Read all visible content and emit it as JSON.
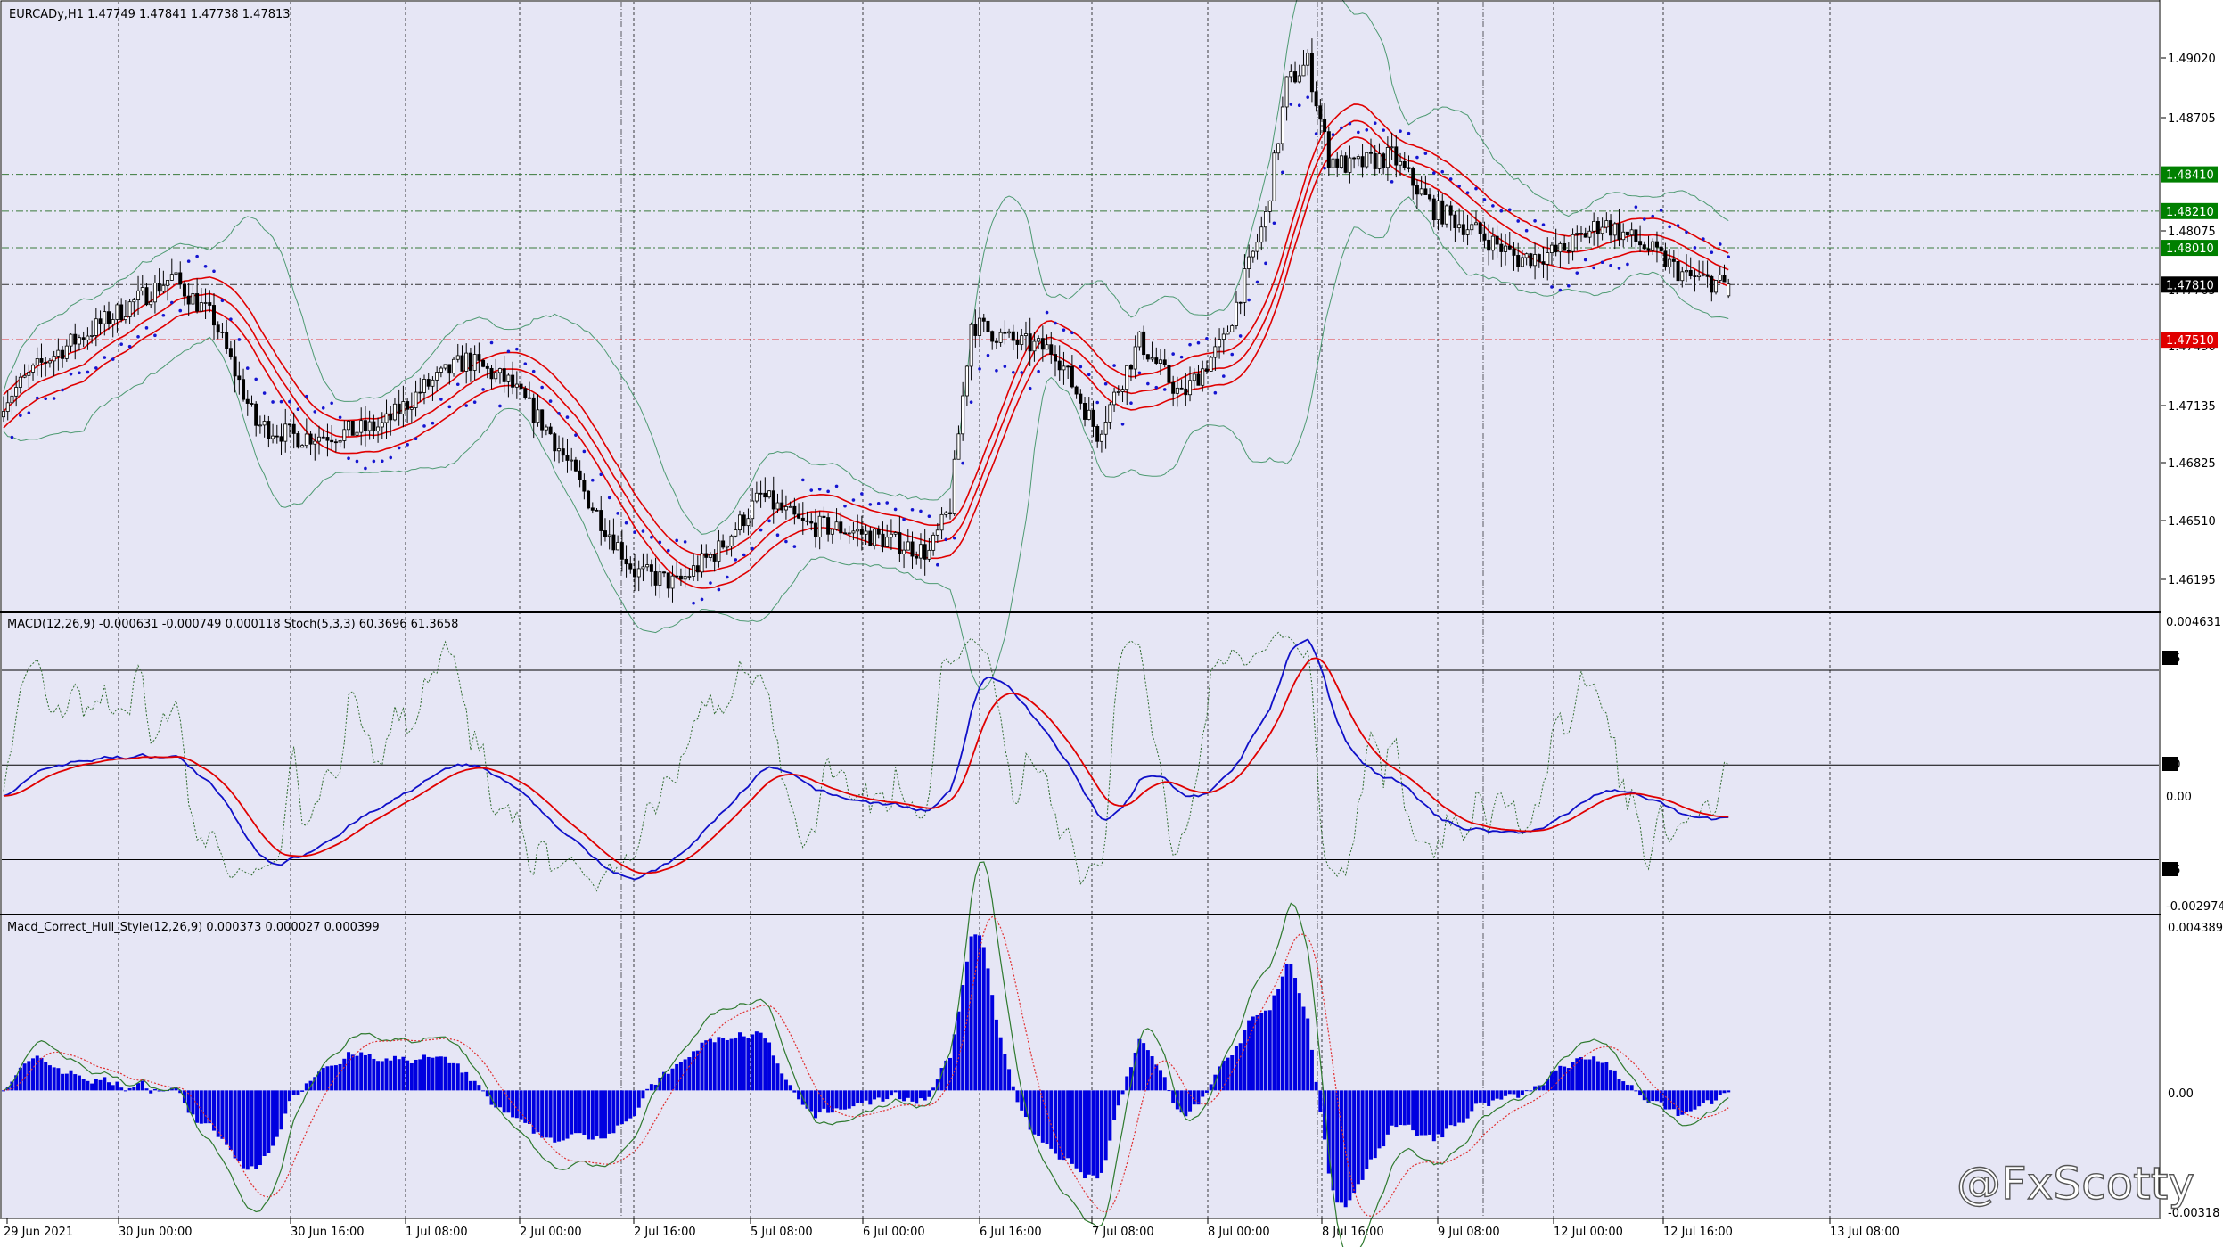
{
  "symbol_info": "EURCADy,H1  1.47749 1.47841 1.47738 1.47813",
  "macd_info": "MACD(12,26,9) -0.000631 -0.000749 0.000118  Stoch(5,3,3) 60.3696 61.3658",
  "hull_info": "Macd_Correct_Hull_Style(12,26,9) 0.000373 0.000027 0.000399",
  "watermark": "@FxScotty",
  "colors": {
    "background": "#e6e6f5",
    "bull_candle": "#ffffff",
    "bear_candle": "#000000",
    "bands_red": "#e00000",
    "bands_outer": "#4e9a72",
    "psar": "#1515d0",
    "macd_main": "#1010c8",
    "macd_signal": "#e00000",
    "stoch": "#2f6b2f",
    "hull_hist": "#0000e0",
    "hull_line": "#2f7a2f",
    "hull_signal": "#e03030",
    "tag_green": "#008000",
    "tag_red": "#e00000",
    "tag_black": "#000000"
  },
  "price_axis": [
    "1.49020",
    "1.48705",
    "1.48075",
    "1.47765",
    "1.47450",
    "1.47135",
    "1.46825",
    "1.46510",
    "1.46195"
  ],
  "price_tags": [
    {
      "value": "1.48410",
      "color": "green"
    },
    {
      "value": "1.48210",
      "color": "green"
    },
    {
      "value": "1.48010",
      "color": "green"
    },
    {
      "value": "1.47810",
      "color": "black"
    },
    {
      "value": "1.47510",
      "color": "red"
    }
  ],
  "macd_axis": [
    "0.004631",
    "85",
    "50",
    "0.00",
    "15",
    "-0.002974"
  ],
  "hull_axis": [
    "0.004389",
    "0.00",
    "-0.00318"
  ],
  "time_axis": [
    "29 Jun 2021",
    "30 Jun 00:00",
    "30 Jun 16:00",
    "1 Jul 08:00",
    "2 Jul 00:00",
    "2 Jul 16:00",
    "5 Jul 08:00",
    "6 Jul 00:00",
    "6 Jul 16:00",
    "7 Jul 08:00",
    "8 Jul 00:00",
    "8 Jul 16:00",
    "9 Jul 08:00",
    "12 Jul 00:00",
    "12 Jul 16:00",
    "13 Jul 08:00"
  ],
  "chart_data": {
    "type": "candlestick",
    "symbol": "EURCADy",
    "timeframe": "H1",
    "last_bar": {
      "open": 1.47749,
      "high": 1.47841,
      "low": 1.47738,
      "close": 1.47813
    },
    "price_range": [
      1.4607,
      1.4932
    ],
    "horizontal_levels": [
      1.4841,
      1.4821,
      1.4801,
      1.4781,
      1.4751
    ],
    "price_path": [
      [
        0,
        1.4718
      ],
      [
        10,
        1.474
      ],
      [
        20,
        1.4755
      ],
      [
        30,
        1.477
      ],
      [
        40,
        1.4785
      ],
      [
        50,
        1.4762
      ],
      [
        60,
        1.4705
      ],
      [
        70,
        1.4698
      ],
      [
        80,
        1.47
      ],
      [
        90,
        1.4704
      ],
      [
        100,
        1.4725
      ],
      [
        110,
        1.474
      ],
      [
        120,
        1.4728
      ],
      [
        130,
        1.47
      ],
      [
        140,
        1.466
      ],
      [
        150,
        1.4625
      ],
      [
        160,
        1.4618
      ],
      [
        170,
        1.4637
      ],
      [
        180,
        1.4666
      ],
      [
        190,
        1.465
      ],
      [
        200,
        1.4648
      ],
      [
        210,
        1.4642
      ],
      [
        220,
        1.4635
      ],
      [
        225,
        1.466
      ],
      [
        230,
        1.476
      ],
      [
        240,
        1.475
      ],
      [
        250,
        1.4745
      ],
      [
        260,
        1.47
      ],
      [
        270,
        1.475
      ],
      [
        280,
        1.472
      ],
      [
        290,
        1.475
      ],
      [
        300,
        1.4818
      ],
      [
        305,
        1.489
      ],
      [
        310,
        1.4902
      ],
      [
        315,
        1.485
      ],
      [
        320,
        1.4845
      ],
      [
        330,
        1.4851
      ],
      [
        340,
        1.4822
      ],
      [
        350,
        1.481
      ],
      [
        360,
        1.4795
      ],
      [
        370,
        1.4799
      ],
      [
        380,
        1.4815
      ],
      [
        390,
        1.4802
      ],
      [
        400,
        1.4785
      ],
      [
        410,
        1.4781
      ]
    ],
    "panels": [
      {
        "name": "MACD(12,26,9)",
        "values": [
          -0.000631,
          -0.000749,
          0.000118
        ],
        "range": [
          -0.002974,
          0.004631
        ]
      },
      {
        "name": "Stoch(5,3,3)",
        "values": [
          60.3696,
          61.3658
        ],
        "levels": [
          85,
          50,
          15
        ]
      },
      {
        "name": "Macd_Correct_Hull_Style(12,26,9)",
        "values": [
          0.000373,
          2.7e-05,
          0.000399
        ],
        "range": [
          -0.00318,
          0.004389
        ]
      }
    ]
  }
}
